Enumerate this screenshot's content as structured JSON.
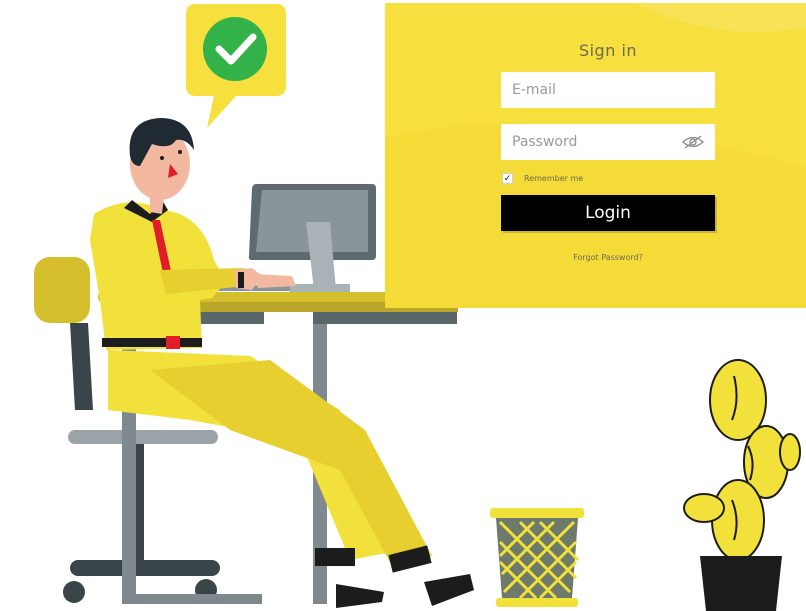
{
  "login": {
    "title": "Sign in",
    "email_placeholder": "E-mail",
    "email_value": "",
    "password_placeholder": "Password",
    "password_value": "",
    "remember_label": "Remember me",
    "remember_checked": true,
    "login_label": "Login",
    "forgot_label": "Forgot Password?",
    "show_password_icon": "eye-slash-icon"
  },
  "illustration": {
    "status_icon": "checkmark-icon",
    "scene": "person-at-desk"
  },
  "colors": {
    "accent_yellow": "#f7df3e",
    "button_black": "#000000",
    "success_green": "#33b24a"
  }
}
